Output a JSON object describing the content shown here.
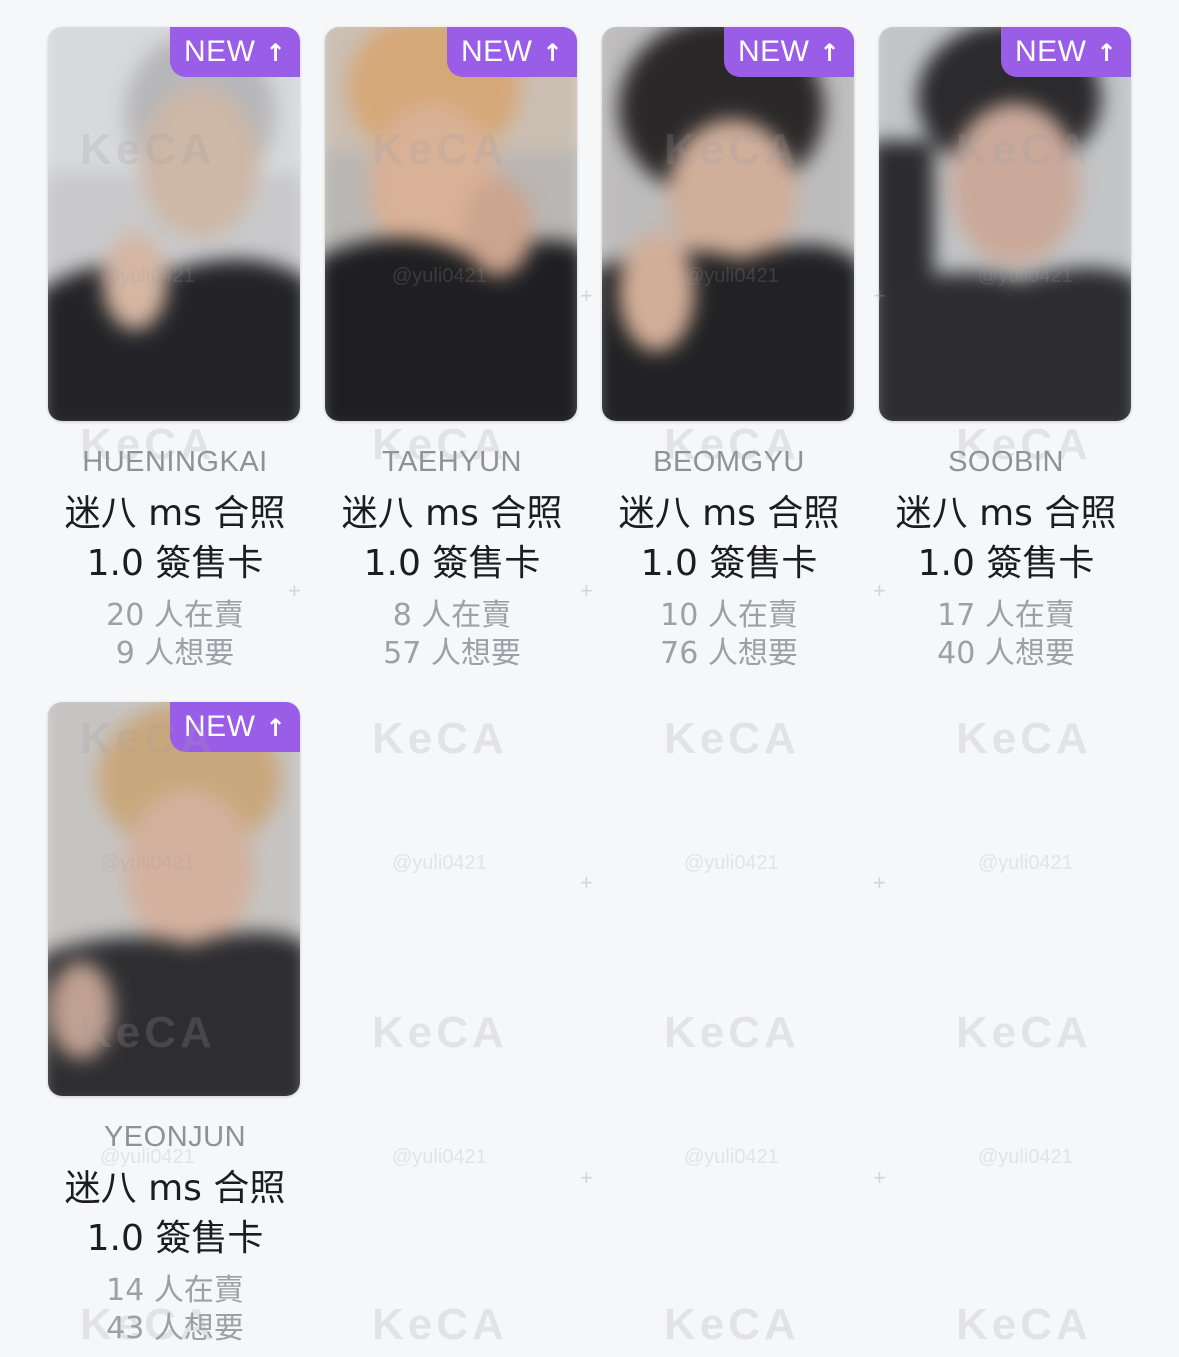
{
  "badge": {
    "label": "NEW",
    "arrow": "↑"
  },
  "cards": [
    {
      "member": "HUENINGKAI",
      "title_line1": "迷八 ms 合照",
      "title_line2": "1.0 簽售卡",
      "selling": "20 人在賣",
      "wanting": "9 人想要"
    },
    {
      "member": "TAEHYUN",
      "title_line1": "迷八 ms 合照",
      "title_line2": "1.0 簽售卡",
      "selling": "8 人在賣",
      "wanting": "57 人想要"
    },
    {
      "member": "BEOMGYU",
      "title_line1": "迷八 ms 合照",
      "title_line2": "1.0 簽售卡",
      "selling": "10 人在賣",
      "wanting": "76 人想要"
    },
    {
      "member": "SOOBIN",
      "title_line1": "迷八 ms 合照",
      "title_line2": "1.0 簽售卡",
      "selling": "17 人在賣",
      "wanting": "40 人想要"
    },
    {
      "member": "YEONJUN",
      "title_line1": "迷八 ms 合照",
      "title_line2": "1.0 簽售卡",
      "selling": "14 人在賣",
      "wanting": "43 人想要"
    }
  ],
  "watermark": {
    "logo": "KeCA",
    "handle": "@yuli0421"
  },
  "colors": {
    "badge": "#9a5de8",
    "background": "#f6f7f9",
    "title": "#1d1d1f",
    "member": "#8f9197",
    "stats": "#9ea0a6"
  }
}
